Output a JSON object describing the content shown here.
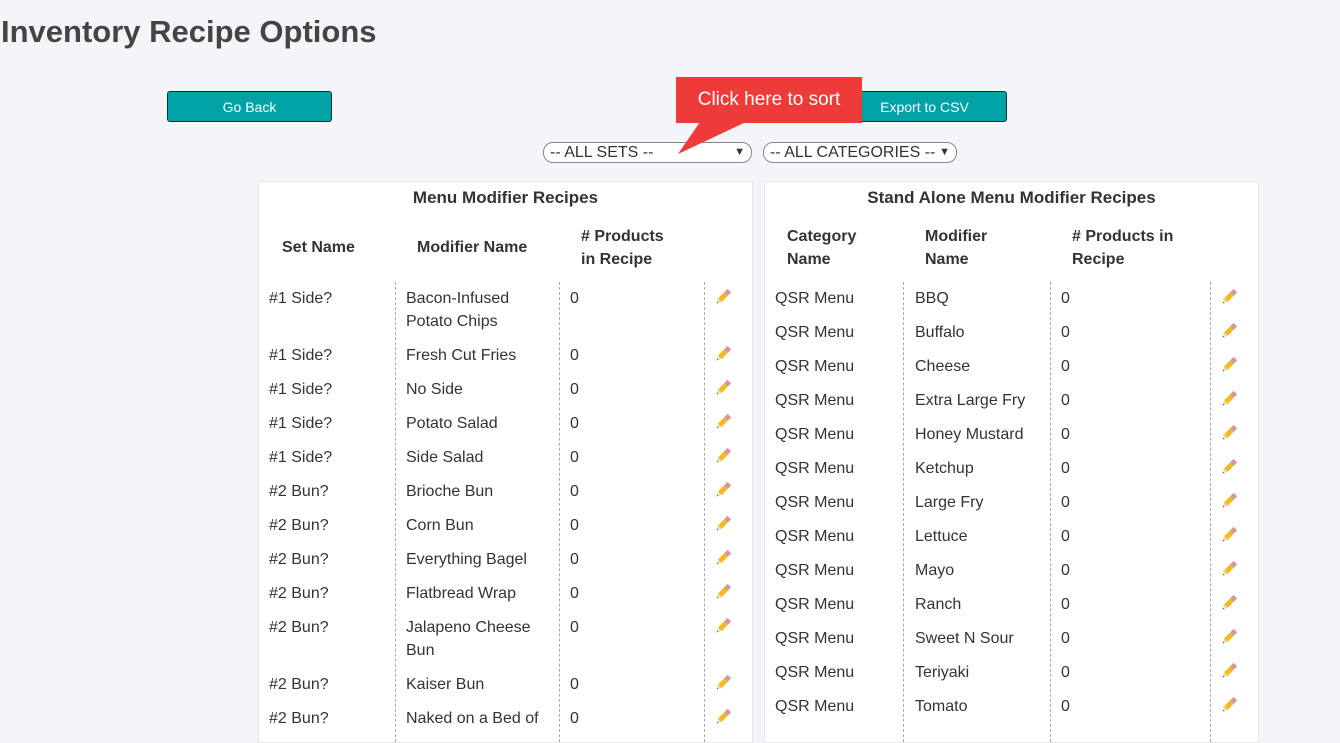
{
  "page_title": "Inventory Recipe Options",
  "buttons": {
    "go_back": "Go Back",
    "export_csv": "Export to CSV"
  },
  "callout": "Click here to sort",
  "filters": {
    "sets": "-- ALL SETS --",
    "categories": "-- ALL CATEGORIES --"
  },
  "icons": {
    "edit": "pencil-icon",
    "dropdown": "chevron-down-icon"
  },
  "colors": {
    "button": "#00a3a5",
    "callout": "#ef3a3a",
    "background": "#f4f5f9"
  },
  "left_table": {
    "title": "Menu Modifier Recipes",
    "headers": [
      "Set Name",
      "Modifier Name",
      "# Products in Recipe"
    ],
    "rows": [
      {
        "set": "#1 Side?",
        "modifier": "Bacon-Infused Potato Chips",
        "count": "0"
      },
      {
        "set": "#1 Side?",
        "modifier": "Fresh Cut Fries",
        "count": "0"
      },
      {
        "set": "#1 Side?",
        "modifier": "No Side",
        "count": "0"
      },
      {
        "set": "#1 Side?",
        "modifier": "Potato Salad",
        "count": "0"
      },
      {
        "set": "#1 Side?",
        "modifier": "Side Salad",
        "count": "0"
      },
      {
        "set": "#2 Bun?",
        "modifier": "Brioche Bun",
        "count": "0"
      },
      {
        "set": "#2 Bun?",
        "modifier": "Corn Bun",
        "count": "0"
      },
      {
        "set": "#2 Bun?",
        "modifier": "Everything Bagel",
        "count": "0"
      },
      {
        "set": "#2 Bun?",
        "modifier": "Flatbread Wrap",
        "count": "0"
      },
      {
        "set": "#2 Bun?",
        "modifier": "Jalapeno Cheese Bun",
        "count": "0"
      },
      {
        "set": "#2 Bun?",
        "modifier": "Kaiser Bun",
        "count": "0"
      },
      {
        "set": "#2 Bun?",
        "modifier": "Naked on a Bed of",
        "count": "0"
      }
    ]
  },
  "right_table": {
    "title": "Stand Alone Menu Modifier Recipes",
    "headers": [
      "Category Name",
      "Modifier Name",
      "# Products in Recipe"
    ],
    "rows": [
      {
        "category": "QSR Menu",
        "modifier": "BBQ",
        "count": "0"
      },
      {
        "category": "QSR Menu",
        "modifier": "Buffalo",
        "count": "0"
      },
      {
        "category": "QSR Menu",
        "modifier": "Cheese",
        "count": "0"
      },
      {
        "category": "QSR Menu",
        "modifier": "Extra Large Fry",
        "count": "0"
      },
      {
        "category": "QSR Menu",
        "modifier": "Honey Mustard",
        "count": "0"
      },
      {
        "category": "QSR Menu",
        "modifier": "Ketchup",
        "count": "0"
      },
      {
        "category": "QSR Menu",
        "modifier": "Large Fry",
        "count": "0"
      },
      {
        "category": "QSR Menu",
        "modifier": "Lettuce",
        "count": "0"
      },
      {
        "category": "QSR Menu",
        "modifier": "Mayo",
        "count": "0"
      },
      {
        "category": "QSR Menu",
        "modifier": "Ranch",
        "count": "0"
      },
      {
        "category": "QSR Menu",
        "modifier": "Sweet N Sour",
        "count": "0"
      },
      {
        "category": "QSR Menu",
        "modifier": "Teriyaki",
        "count": "0"
      },
      {
        "category": "QSR Menu",
        "modifier": "Tomato",
        "count": "0"
      }
    ]
  }
}
